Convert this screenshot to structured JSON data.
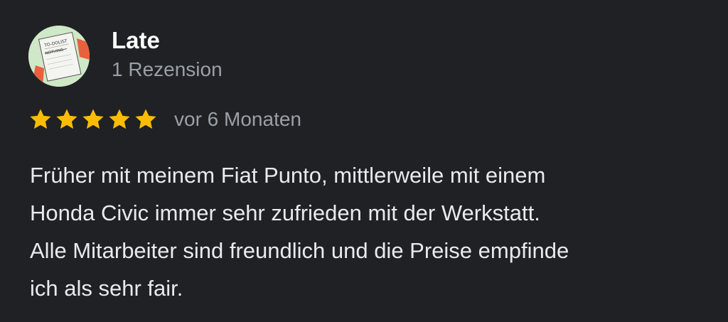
{
  "review": {
    "author": {
      "name": "Late",
      "meta": "1 Rezension",
      "avatar_icon": "note-paper-icon",
      "avatar_text_top": "TO-DOLIST",
      "avatar_text_bottom": "NOTHING"
    },
    "rating": {
      "stars": 5,
      "max": 5,
      "color": "#fbbc04"
    },
    "time_ago": "vor 6 Monaten",
    "text_lines": [
      "Früher mit meinem Fiat Punto, mittlerweile mit einem",
      "Honda Civic immer sehr zufrieden mit der Werkstatt.",
      "Alle Mitarbeiter sind freundlich und die Preise empfinde",
      "ich als sehr fair."
    ]
  }
}
